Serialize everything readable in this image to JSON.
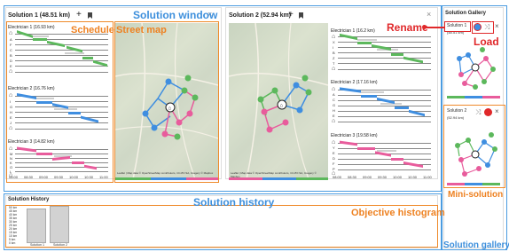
{
  "colors": {
    "blue": "#4a9be0",
    "orange": "#ef8a2a",
    "red": "#e0282a",
    "green": "#5cb85c",
    "route_blue": "#3f8ee0",
    "pink": "#e85c9c"
  },
  "annotations": {
    "solution_window": "Solution window",
    "schedule": "Schedule",
    "street_map": "Street map",
    "rename": "Rename",
    "load": "Load",
    "solution_history": "Solution history",
    "objective_histogram": "Objective histogram",
    "mini_solution": "Mini-solution",
    "solution_gallery": "Solution gallery"
  },
  "solution1": {
    "title": "Solution 1 (48.51 km)",
    "electricians": [
      {
        "name": "Electrician 1 (16.93 km)",
        "rows": [
          "A",
          "F",
          "C",
          "B",
          "D",
          "E"
        ]
      },
      {
        "name": "Electrician 2 (16.76 km)",
        "rows": [
          "I",
          "G",
          "H",
          "E",
          "J"
        ]
      },
      {
        "name": "Electrician 3 (14.82 km)",
        "rows": [
          "M",
          "N",
          "K",
          "O",
          "L"
        ]
      }
    ]
  },
  "solution2": {
    "title": "Solution 2 (52.94 km)",
    "electricians": [
      {
        "name": "Electrician 1 (16.2 km)",
        "rows": [
          "X",
          "I",
          "B",
          "Z",
          "T"
        ]
      },
      {
        "name": "Electrician 2 (17.16 km)",
        "rows": [
          "A",
          "C",
          "G",
          "H",
          "E"
        ]
      },
      {
        "name": "Electrician 3 (19.58 km)",
        "rows": [
          "Y",
          "E",
          "D",
          "F",
          "P"
        ]
      }
    ]
  },
  "time_ticks": [
    "08:00",
    "08:30",
    "09:00",
    "09:30",
    "10:00",
    "10:30",
    "11:00"
  ],
  "map_credit": "Leaflet | Map data © OpenStreetMap contributors, CC-BY-SA, Imagery © Mapbox",
  "gallery": {
    "title": "Solution Gallery",
    "items": [
      {
        "label": "Solution 1",
        "sub": "(48.51 km)"
      },
      {
        "label": "Solution 2",
        "sub": "(52.94 km)"
      }
    ]
  },
  "history": {
    "title": "Solution History",
    "y_ticks": [
      "50 km",
      "45 km",
      "40 km",
      "35 km",
      "30 km",
      "25 km",
      "20 km",
      "15 km",
      "10 km",
      "5 km",
      "0 km"
    ],
    "bars": [
      {
        "label": "Solution 1",
        "value": 48.51
      },
      {
        "label": "Solution 2",
        "value": 52.94
      }
    ]
  },
  "controls": {
    "add": "+",
    "close": "×",
    "bookmark": "bookmark-icon"
  }
}
